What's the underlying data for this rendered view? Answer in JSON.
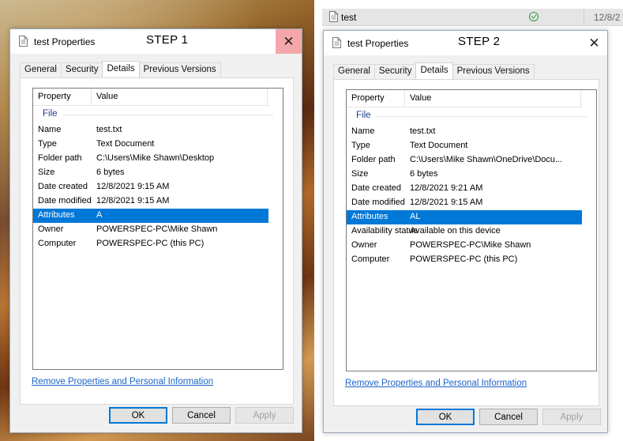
{
  "explorer": {
    "file_name": "test",
    "date_partial": "12/8/2"
  },
  "dialog1": {
    "title": "test Properties",
    "step_label": "STEP 1",
    "tabs": [
      "General",
      "Security",
      "Details",
      "Previous Versions"
    ],
    "active_tab": "Details",
    "columns": [
      "Property",
      "Value"
    ],
    "group": "File",
    "rows": [
      {
        "k": "Name",
        "v": "test.txt"
      },
      {
        "k": "Type",
        "v": "Text Document"
      },
      {
        "k": "Folder path",
        "v": "C:\\Users\\Mike Shawn\\Desktop"
      },
      {
        "k": "Size",
        "v": "6 bytes"
      },
      {
        "k": "Date created",
        "v": "12/8/2021 9:15 AM"
      },
      {
        "k": "Date modified",
        "v": "12/8/2021 9:15 AM"
      },
      {
        "k": "Attributes",
        "v": "A"
      },
      {
        "k": "Owner",
        "v": "POWERSPEC-PC\\Mike Shawn"
      },
      {
        "k": "Computer",
        "v": "POWERSPEC-PC (this PC)"
      }
    ],
    "selected_row": 6,
    "link": "Remove Properties and Personal Information",
    "buttons": {
      "ok": "OK",
      "cancel": "Cancel",
      "apply": "Apply"
    }
  },
  "dialog2": {
    "title": "test Properties",
    "step_label": "STEP 2",
    "tabs": [
      "General",
      "Security",
      "Details",
      "Previous Versions"
    ],
    "active_tab": "Details",
    "columns": [
      "Property",
      "Value"
    ],
    "group": "File",
    "rows": [
      {
        "k": "Name",
        "v": "test.txt"
      },
      {
        "k": "Type",
        "v": "Text Document"
      },
      {
        "k": "Folder path",
        "v": "C:\\Users\\Mike Shawn\\OneDrive\\Docu..."
      },
      {
        "k": "Size",
        "v": "6 bytes"
      },
      {
        "k": "Date created",
        "v": "12/8/2021 9:21 AM"
      },
      {
        "k": "Date modified",
        "v": "12/8/2021 9:15 AM"
      },
      {
        "k": "Attributes",
        "v": "AL"
      },
      {
        "k": "Availability status",
        "v": "Available on this device"
      },
      {
        "k": "Owner",
        "v": "POWERSPEC-PC\\Mike Shawn"
      },
      {
        "k": "Computer",
        "v": "POWERSPEC-PC (this PC)"
      }
    ],
    "selected_row": 6,
    "link": "Remove Properties and Personal Information",
    "buttons": {
      "ok": "OK",
      "cancel": "Cancel",
      "apply": "Apply"
    }
  },
  "colors": {
    "selection": "#0078d7",
    "link": "#1d64c8",
    "close_hover": "#f4a7aa",
    "group_text": "#1e3c8c"
  },
  "icons": {
    "file": "document-icon",
    "close": "close-icon",
    "sync": "sync-status-check-icon"
  }
}
